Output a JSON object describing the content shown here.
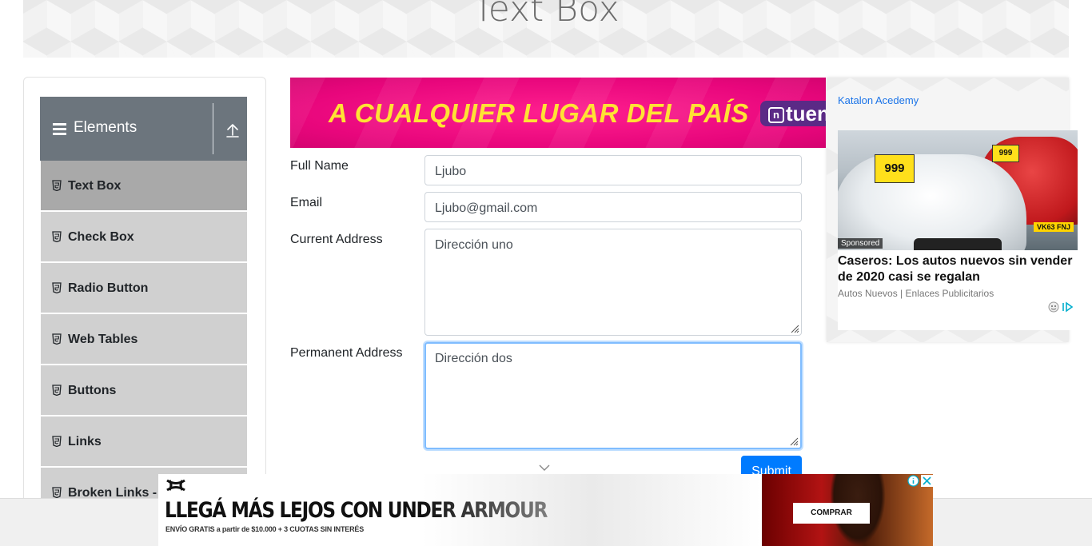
{
  "page": {
    "title": "Text Box"
  },
  "sidebar": {
    "group_title": "Elements",
    "items": [
      {
        "label": "Text Box",
        "active": true
      },
      {
        "label": "Check Box",
        "active": false
      },
      {
        "label": "Radio Button",
        "active": false
      },
      {
        "label": "Web Tables",
        "active": false
      },
      {
        "label": "Buttons",
        "active": false
      },
      {
        "label": "Links",
        "active": false
      },
      {
        "label": "Broken Links - I",
        "active": false
      }
    ]
  },
  "form": {
    "full_name": {
      "label": "Full Name",
      "value": "Ljubo"
    },
    "email": {
      "label": "Email",
      "value": "Ljubo@gmail.com"
    },
    "current_address": {
      "label": "Current Address",
      "value": "Dirección uno"
    },
    "permanent_address": {
      "label": "Permanent Address",
      "value": "Dirección dos"
    },
    "submit_label": "Submit"
  },
  "ads": {
    "top": {
      "headline": "A CUALQUIER LUGAR DEL PAÍS",
      "brand": "tuen",
      "brand_mark": "n"
    },
    "right": {
      "source": "Katalon Acedemy",
      "badge": "Sponsored",
      "headline": "Caseros: Los autos nuevos sin vender de 2020 casi se regalan",
      "advertiser": "Autos Nuevos | Enlaces Publicitarios",
      "price_tag": "999",
      "plate": "VK63 FNJ"
    },
    "bottom": {
      "headline": "LLEGÁ MÁS LEJOS CON UNDER ARMOUR",
      "sub": "ENVÍO GRATIS a partir de $10.000 + 3 CUOTAS SIN INTERÉS",
      "cta": "COMPRAR"
    }
  },
  "colors": {
    "sidebar_header": "#6c757d",
    "sidebar_item": "#d0d0d0",
    "sidebar_item_active": "#a9a9a9",
    "primary": "#007bff",
    "focus_border": "#80bdff",
    "ad_pink": "#e8067c",
    "ad_yellow": "#ffe234"
  }
}
